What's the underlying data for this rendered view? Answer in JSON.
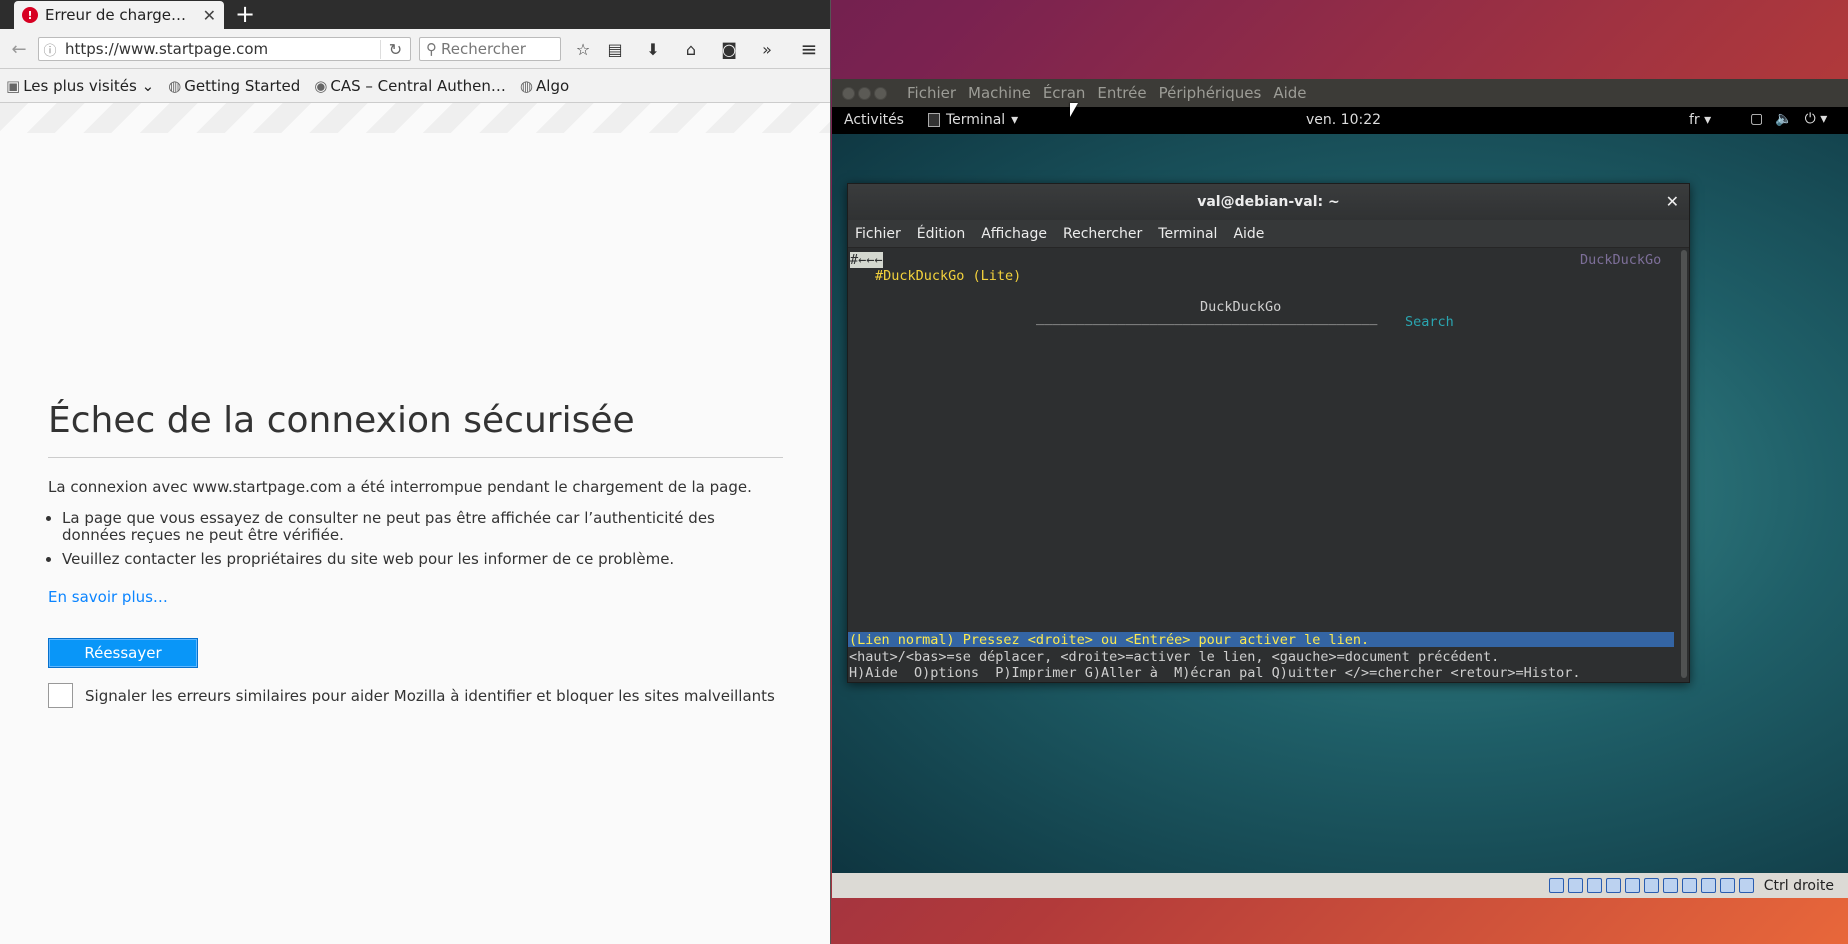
{
  "firefox": {
    "tab_title": "Erreur de chargeme…",
    "tab_close": "✕",
    "new_tab": "+",
    "url": "https://www.startpage.com",
    "search_placeholder": "Rechercher",
    "bookmarks": [
      "Les plus visités",
      "Getting Started",
      "CAS – Central Authen…",
      "Algo"
    ],
    "error": {
      "title": "Échec de la connexion sécurisée",
      "intro": "La connexion avec www.startpage.com a été interrompue pendant le chargement de la page.",
      "bullet1": "La page que vous essayez de consulter ne peut pas être affichée car l’authenticité des données reçues ne peut être vérifiée.",
      "bullet2": "Veuillez contacter les propriétaires du site web pour les informer de ce problème.",
      "learn_more": "En savoir plus…",
      "retry": "Réessayer",
      "report": "Signaler les erreurs similaires pour aider Mozilla à identifier et bloquer les sites malveillants"
    }
  },
  "virtualbox": {
    "menu": [
      "Fichier",
      "Machine",
      "Écran",
      "Entrée",
      "Périphériques",
      "Aide"
    ],
    "host_key": "Ctrl droite"
  },
  "guest": {
    "activities": "Activités",
    "app_name": "Terminal",
    "clock": "ven. 10:22",
    "lang": "fr",
    "terminal": {
      "title": "val@debian-val: ~",
      "menu": [
        "Fichier",
        "Édition",
        "Affichage",
        "Rechercher",
        "Terminal",
        "Aide"
      ],
      "lines": {
        "top_left": "#←←←",
        "top_right": "DuckDuckGo",
        "heading": "#DuckDuckGo (Lite)",
        "form_label": "DuckDuckGo",
        "input_line": "__________________________________________",
        "search_btn": "Search",
        "status": "(Lien normal) Pressez <droite> ou <Entrée> pour activer le lien.",
        "help1": "<haut>/<bas>=se déplacer, <droite>=activer le lien, <gauche>=document précédent.",
        "help2": "H)Aide  O)ptions  P)Imprimer G)Aller à  M)écran pal Q)uitter </>=chercher <retour>=Histor."
      }
    }
  }
}
